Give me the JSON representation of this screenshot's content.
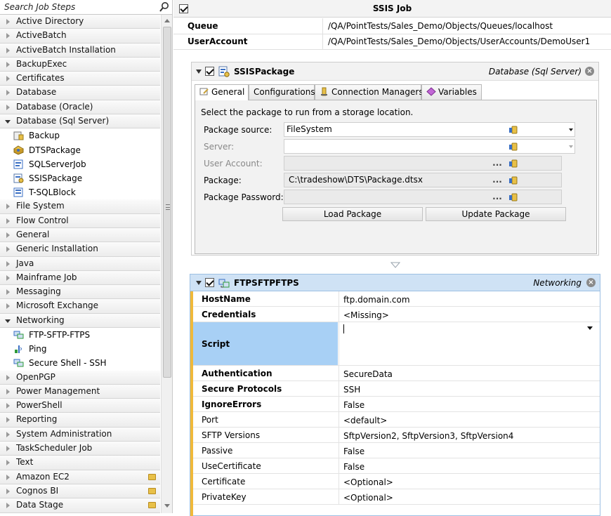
{
  "search": {
    "placeholder": "Search Job Steps"
  },
  "tree": {
    "groups_top": [
      {
        "label": "Active Directory"
      },
      {
        "label": "ActiveBatch"
      },
      {
        "label": "ActiveBatch Installation"
      },
      {
        "label": "BackupExec"
      },
      {
        "label": "Certificates"
      },
      {
        "label": "Database"
      },
      {
        "label": "Database (Oracle)"
      }
    ],
    "sql_group": {
      "label": "Database (Sql Server)"
    },
    "sql_items": [
      {
        "label": "Backup",
        "icon": "backup-icon"
      },
      {
        "label": "DTSPackage",
        "icon": "dts-package-icon"
      },
      {
        "label": "SQLServerJob",
        "icon": "sql-server-job-icon"
      },
      {
        "label": "SSISPackage",
        "icon": "ssis-package-icon"
      },
      {
        "label": "T-SQLBlock",
        "icon": "tsql-block-icon"
      }
    ],
    "groups_mid": [
      {
        "label": "File System"
      },
      {
        "label": "Flow Control"
      },
      {
        "label": "General"
      },
      {
        "label": "Generic Installation"
      },
      {
        "label": "Java"
      },
      {
        "label": "Mainframe Job"
      },
      {
        "label": "Messaging"
      },
      {
        "label": "Microsoft Exchange"
      }
    ],
    "net_group": {
      "label": "Networking"
    },
    "net_items": [
      {
        "label": "FTP-SFTP-FTPS",
        "icon": "ftp-icon"
      },
      {
        "label": "Ping",
        "icon": "ping-icon"
      },
      {
        "label": "Secure Shell - SSH",
        "icon": "ssh-icon"
      }
    ],
    "groups_bottom": [
      {
        "label": "OpenPGP"
      },
      {
        "label": "Power Management"
      },
      {
        "label": "PowerShell"
      },
      {
        "label": "Reporting"
      },
      {
        "label": "System Administration"
      },
      {
        "label": "TaskScheduler Job"
      },
      {
        "label": "Text"
      },
      {
        "label": "Amazon EC2"
      },
      {
        "label": "Cognos BI"
      },
      {
        "label": "Data Stage"
      }
    ]
  },
  "job": {
    "title": "SSIS Job",
    "queue_label": "Queue",
    "queue_value": "/QA/PointTests/Sales_Demo/Objects/Queues/localhost",
    "account_label": "UserAccount",
    "account_value": "/QA/PointTests/Sales_Demo/Objects/UserAccounts/DemoUser1"
  },
  "ssis": {
    "name": "SSISPackage",
    "category": "Database (Sql Server)",
    "tabs": [
      "General",
      "Configurations",
      "Connection Managers",
      "Variables"
    ],
    "hint": "Select the package to run from a storage location.",
    "package_source_label": "Package source:",
    "package_source_value": "FileSystem",
    "server_label": "Server:",
    "user_account_label": "User Account:",
    "package_label": "Package:",
    "package_value": "C:\\tradeshow\\DTS\\Package.dtsx",
    "password_label": "Package Password:",
    "load_button": "Load Package",
    "update_button": "Update Package",
    "ellipsis": "..."
  },
  "ftp": {
    "name": "FTPSFTPFTPS",
    "category": "Networking",
    "rows": [
      {
        "key": "HostName",
        "value": "ftp.domain.com",
        "bold": true
      },
      {
        "key": "Credentials",
        "value": "<Missing>",
        "bold": true
      },
      {
        "key": "Script",
        "value": "",
        "bold": true
      },
      {
        "key": "Authentication",
        "value": "SecureData",
        "bold": true
      },
      {
        "key": "Secure Protocols",
        "value": "SSH",
        "bold": true
      },
      {
        "key": "IgnoreErrors",
        "value": "False",
        "bold": true
      },
      {
        "key": "Port",
        "value": "<default>",
        "bold": false
      },
      {
        "key": "SFTP Versions",
        "value": "SftpVersion2, SftpVersion3, SftpVersion4",
        "bold": false
      },
      {
        "key": "Passive",
        "value": "False",
        "bold": false
      },
      {
        "key": "UseCertificate",
        "value": "False",
        "bold": false
      },
      {
        "key": "Certificate",
        "value": "<Optional>",
        "bold": false
      },
      {
        "key": "PrivateKey",
        "value": "<Optional>",
        "bold": false
      }
    ]
  },
  "colors": {
    "selection": "#a8d0f5",
    "ftp_header": "#cfe2f5",
    "accent": "#f0b93a"
  }
}
